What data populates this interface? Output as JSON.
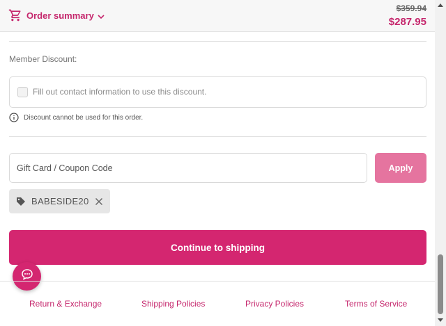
{
  "header": {
    "order_summary_label": "Order summary",
    "original_price": "$359.94",
    "total_price": "$287.95",
    "accent_color": "#c5266c"
  },
  "member_discount": {
    "label": "Member Discount:",
    "checkbox_label": "Fill out contact information to use this discount.",
    "checked": false,
    "notice": "Discount cannot be used for this order."
  },
  "coupon": {
    "placeholder": "Gift Card / Coupon Code",
    "value": "",
    "apply_label": "Apply",
    "applied_code": "BABESIDE20"
  },
  "actions": {
    "continue_label": "Continue to shipping",
    "button_color": "#d42670"
  },
  "footer": {
    "links": [
      "Return & Exchange",
      "Shipping Policies",
      "Privacy Policies",
      "Terms of Service"
    ]
  },
  "icons": {
    "cart": "cart-icon",
    "chevron": "chevron-down-icon",
    "info": "info-icon",
    "tag": "tag-icon",
    "remove": "close-icon",
    "chat": "chat-icon"
  }
}
